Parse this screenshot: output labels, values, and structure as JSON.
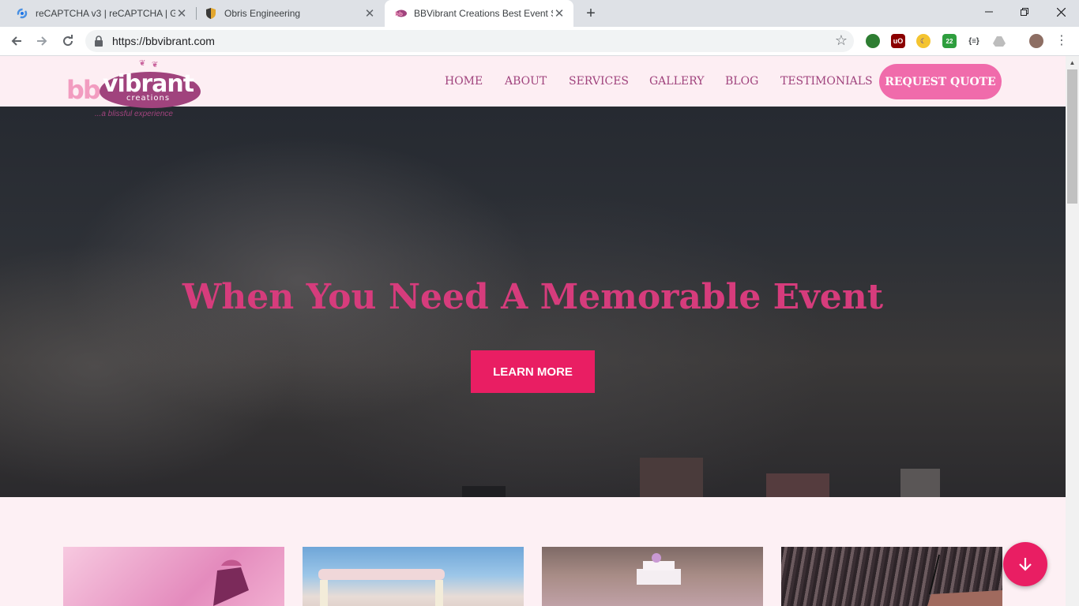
{
  "browser": {
    "tabs": [
      {
        "title": "reCAPTCHA v3  |  reCAPTCHA  |  G",
        "active": false,
        "favicon": "recaptcha-icon"
      },
      {
        "title": "Obris Engineering",
        "active": false,
        "favicon": "shield-icon"
      },
      {
        "title": "BBVibrant Creations Best Event S",
        "active": true,
        "favicon": "bbvibrant-icon"
      }
    ],
    "url": "https://bbvibrant.com",
    "extension_badge": "22"
  },
  "site": {
    "logo": {
      "bb": "bb",
      "vibrant": "vibrant",
      "creations": "creations",
      "tagline": "...a blissful experience"
    },
    "nav": [
      "HOME",
      "ABOUT",
      "SERVICES",
      "GALLERY",
      "BLOG",
      "TESTIMONIALS"
    ],
    "cta_label": "REQUEST QUOTE",
    "hero": {
      "title": "When You Need A Memorable Event",
      "button_label": "LEARN MORE"
    }
  },
  "colors": {
    "accent": "#e91e63",
    "brand_purple": "#a0437d",
    "cta_pink": "#f06bab",
    "page_bg": "#fdf0f4"
  }
}
